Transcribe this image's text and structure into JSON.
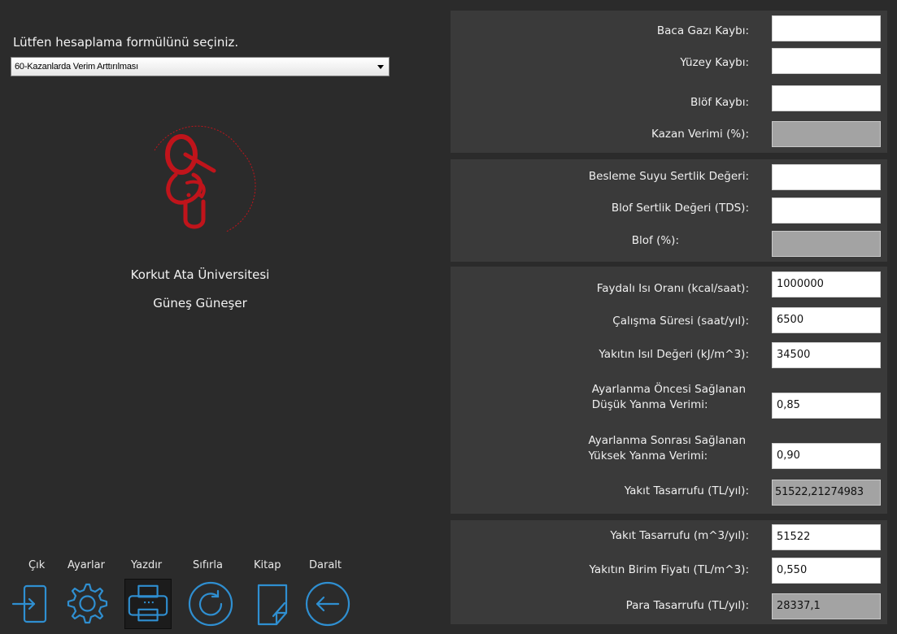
{
  "formula": {
    "prompt": "Lütfen hesaplama formülünü seçiniz.",
    "selected": "60-Kazanlarda Verim Arttırılması"
  },
  "author": {
    "university": "Korkut Ata Üniversitesi",
    "name": "Güneş Güneşer"
  },
  "toolbar": {
    "exit": "Çık",
    "settings": "Ayarlar",
    "print": "Yazdır",
    "reset": "Sıfırla",
    "book": "Kitap",
    "collapse": "Daralt"
  },
  "panel1": {
    "baca_label": "Baca Gazı Kaybı:",
    "baca_value": "",
    "yuzey_label": "Yüzey Kaybı:",
    "yuzey_value": "",
    "blof_label": "Blöf Kaybı:",
    "blof_value": "",
    "kazan_label": "Kazan Verimi (%):",
    "kazan_value": ""
  },
  "panel2": {
    "besleme_label": "Besleme Suyu Sertlik Değeri:",
    "besleme_value": "",
    "tds_label": "Blof Sertlik Değeri (TDS):",
    "tds_value": "",
    "blof_label": "Blof (%):",
    "blof_value": ""
  },
  "panel3": {
    "faydali_label": "Faydalı Isı Oranı (kcal/saat):",
    "faydali_value": "1000000",
    "calisma_label": "Çalışma Süresi (saat/yıl):",
    "calisma_value": "6500",
    "yakit_isil_label": "Yakıtın Isıl Değeri (kJ/m^3):",
    "yakit_isil_value": "34500",
    "oncesi_label_1": "Ayarlanma Öncesi Sağlanan",
    "oncesi_label_2": "Düşük Yanma Verimi:",
    "oncesi_value": "0,85",
    "sonrasi_label_1": "Ayarlanma Sonrası Sağlanan",
    "sonrasi_label_2": "Yüksek Yanma Verimi:",
    "sonrasi_value": "0,90",
    "tasarruf_tl_label": "Yakıt Tasarrufu (TL/yıl):",
    "tasarruf_tl_value": "51522,21274983"
  },
  "panel4": {
    "tasarruf_m3_label": "Yakıt Tasarrufu (m^3/yıl):",
    "tasarruf_m3_value": "51522",
    "birim_fiyat_label": "Yakıtın Birim Fiyatı (TL/m^3):",
    "birim_fiyat_value": "0,550",
    "para_label": "Para Tasarrufu (TL/yıl):",
    "para_value": "28337,1"
  },
  "colors": {
    "background": "#2b2b2b",
    "panel": "#3a3a3a",
    "icon": "#2f8fd1",
    "logo": "#c0141b",
    "readonly_field": "#a3a3a3"
  },
  "icons": [
    "exit-icon",
    "gear-icon",
    "printer-icon",
    "refresh-icon",
    "book-icon",
    "back-arrow-icon"
  ]
}
